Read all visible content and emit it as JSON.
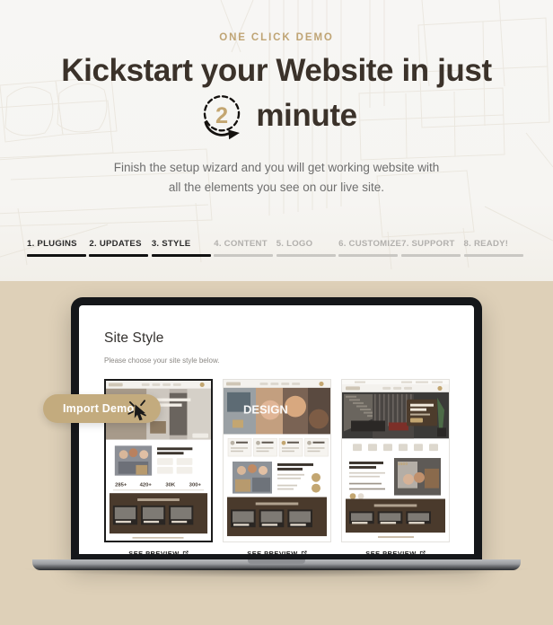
{
  "hero": {
    "eyebrow": "ONE CLICK DEMO",
    "headline_line1": "Kickstart your Website in just",
    "minute_word": "minute",
    "clock_number": "2",
    "clock_icon": "clock-two-minute-icon",
    "subtext_line1": "Finish the setup wizard and you will get working website with",
    "subtext_line2": "all the elements you see on our live site."
  },
  "steps": [
    {
      "label": "1. PLUGINS",
      "state": "done"
    },
    {
      "label": "2. UPDATES",
      "state": "done"
    },
    {
      "label": "3. STYLE",
      "state": "done"
    },
    {
      "label": "4. CONTENT",
      "state": "todo"
    },
    {
      "label": "5. LOGO",
      "state": "todo"
    },
    {
      "label": "6. CUSTOMIZE",
      "state": "todo"
    },
    {
      "label": "7. SUPPORT",
      "state": "todo"
    },
    {
      "label": "8. READY!",
      "state": "todo"
    }
  ],
  "wizard": {
    "title": "Site Style",
    "subtitle": "Please choose your site style below.",
    "cards": [
      {
        "name": "apartments-style",
        "selected": true,
        "hero_text": "Grand Guest St Apartments",
        "stats": [
          "285+",
          "420+",
          "30K",
          "300+"
        ],
        "dark_section_title": "What we offer for you",
        "preview_label": "SEE PREVIEW",
        "preview_icon": "external-link-icon"
      },
      {
        "name": "design-style",
        "selected": false,
        "hero_text": "DESIGN",
        "dark_section_title": "What we offer for you",
        "preview_label": "SEE PREVIEW",
        "preview_icon": "external-link-icon"
      },
      {
        "name": "living-style",
        "selected": false,
        "hero_text": "Beautiful Living Solutions.",
        "dark_section_title": "What we offer for you",
        "preview_label": "SEE PREVIEW",
        "preview_icon": "external-link-icon"
      }
    ]
  },
  "import_demo": {
    "label": "Import Demo",
    "cursor_icon": "click-cursor-icon"
  },
  "colors": {
    "accent_gold": "#c3ab7e",
    "eyebrow_gold": "#bfa474",
    "headline_dark": "#3b322a",
    "step_done": "#111111",
    "step_todo": "#c9c7c3",
    "page_bottom_bg": "#ded0b8",
    "hero_bg": "#f7f6f4"
  }
}
